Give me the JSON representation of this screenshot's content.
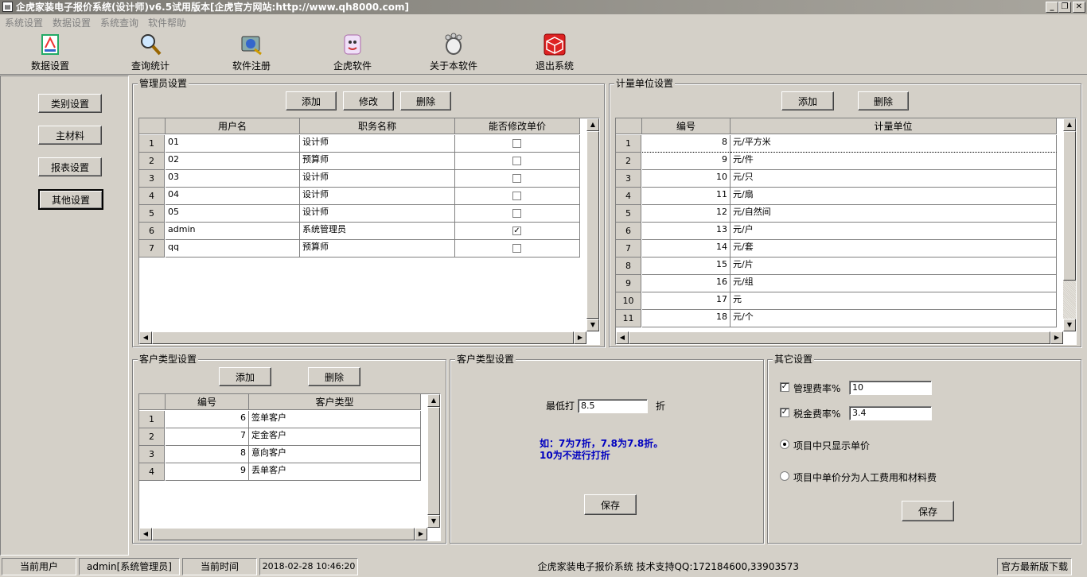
{
  "window": {
    "title": "企虎家装电子报价系统(设计师)v6.5试用版本[企虎官方网站:http://www.qh8000.com]",
    "controls": [
      "_",
      "❐",
      "✕"
    ]
  },
  "menu": [
    "系统设置",
    "数据设置",
    "系统查询",
    "软件帮助"
  ],
  "toolbar": [
    {
      "label": "数据设置",
      "icon": "data-settings-icon"
    },
    {
      "label": "查询统计",
      "icon": "magnifier-icon"
    },
    {
      "label": "软件注册",
      "icon": "register-icon"
    },
    {
      "label": "企虎软件",
      "icon": "tiger-soft-icon"
    },
    {
      "label": "关于本软件",
      "icon": "about-icon"
    },
    {
      "label": "退出系统",
      "icon": "exit-icon"
    }
  ],
  "sidebar": {
    "items": [
      {
        "label": "类别设置"
      },
      {
        "label": "主材料"
      },
      {
        "label": "报表设置"
      },
      {
        "label": "其他设置"
      }
    ],
    "active_index": 3
  },
  "admin": {
    "title": "管理员设置",
    "buttons": {
      "add": "添加",
      "edit": "修改",
      "delete": "删除"
    },
    "columns": [
      "用户名",
      "职务名称",
      "能否修改单价"
    ],
    "rows": [
      {
        "no": "1",
        "user": "01",
        "role": "设计师",
        "can_edit": false
      },
      {
        "no": "2",
        "user": "02",
        "role": "预算师",
        "can_edit": false
      },
      {
        "no": "3",
        "user": "03",
        "role": "设计师",
        "can_edit": false
      },
      {
        "no": "4",
        "user": "04",
        "role": "设计师",
        "can_edit": false
      },
      {
        "no": "5",
        "user": "05",
        "role": "设计师",
        "can_edit": false
      },
      {
        "no": "6",
        "user": "admin",
        "role": "系统管理员",
        "can_edit": true
      },
      {
        "no": "7",
        "user": "qq",
        "role": "预算师",
        "can_edit": false
      }
    ]
  },
  "units": {
    "title": "计量单位设置",
    "buttons": {
      "add": "添加",
      "delete": "删除"
    },
    "columns": [
      "编号",
      "计量单位"
    ],
    "rows": [
      {
        "no": "1",
        "id": "8",
        "unit": "元/平方米"
      },
      {
        "no": "2",
        "id": "9",
        "unit": "元/件"
      },
      {
        "no": "3",
        "id": "10",
        "unit": "元/只"
      },
      {
        "no": "4",
        "id": "11",
        "unit": "元/扇"
      },
      {
        "no": "5",
        "id": "12",
        "unit": "元/自然间"
      },
      {
        "no": "6",
        "id": "13",
        "unit": "元/户"
      },
      {
        "no": "7",
        "id": "14",
        "unit": "元/套"
      },
      {
        "no": "8",
        "id": "15",
        "unit": "元/片"
      },
      {
        "no": "9",
        "id": "16",
        "unit": "元/组"
      },
      {
        "no": "10",
        "id": "17",
        "unit": "元"
      },
      {
        "no": "11",
        "id": "18",
        "unit": "元/个"
      }
    ]
  },
  "customer_types": {
    "title": "客户类型设置",
    "buttons": {
      "add": "添加",
      "delete": "删除"
    },
    "columns": [
      "编号",
      "客户类型"
    ],
    "rows": [
      {
        "no": "1",
        "id": "6",
        "type": "签单客户"
      },
      {
        "no": "2",
        "id": "7",
        "type": "定金客户"
      },
      {
        "no": "3",
        "id": "8",
        "type": "意向客户"
      },
      {
        "no": "4",
        "id": "9",
        "type": "丢单客户"
      }
    ]
  },
  "discount": {
    "title": "客户类型设置",
    "label": "最低打",
    "value": "8.5",
    "unit": "折",
    "hint_line1": "如：7为7折，7.8为7.8折。",
    "hint_line2": "10为不进行打折",
    "save": "保存"
  },
  "other": {
    "title": "其它设置",
    "mgmt_label": "管理费率%",
    "mgmt_checked": true,
    "mgmt_value": "10",
    "tax_label": "税金费率%",
    "tax_checked": true,
    "tax_value": "3.4",
    "radio1": "项目中只显示单价",
    "radio2": "项目中单价分为人工费用和材料费",
    "radio_selected": 1,
    "save": "保存"
  },
  "status": {
    "user_label": "当前用户",
    "user_value": "admin[系统管理员]",
    "time_label": "当前时间",
    "time_value": "2018-02-28 10:46:20",
    "support": "企虎家装电子报价系统   技术支持QQ:172184600,33903573",
    "download": "官方最新版下载"
  }
}
